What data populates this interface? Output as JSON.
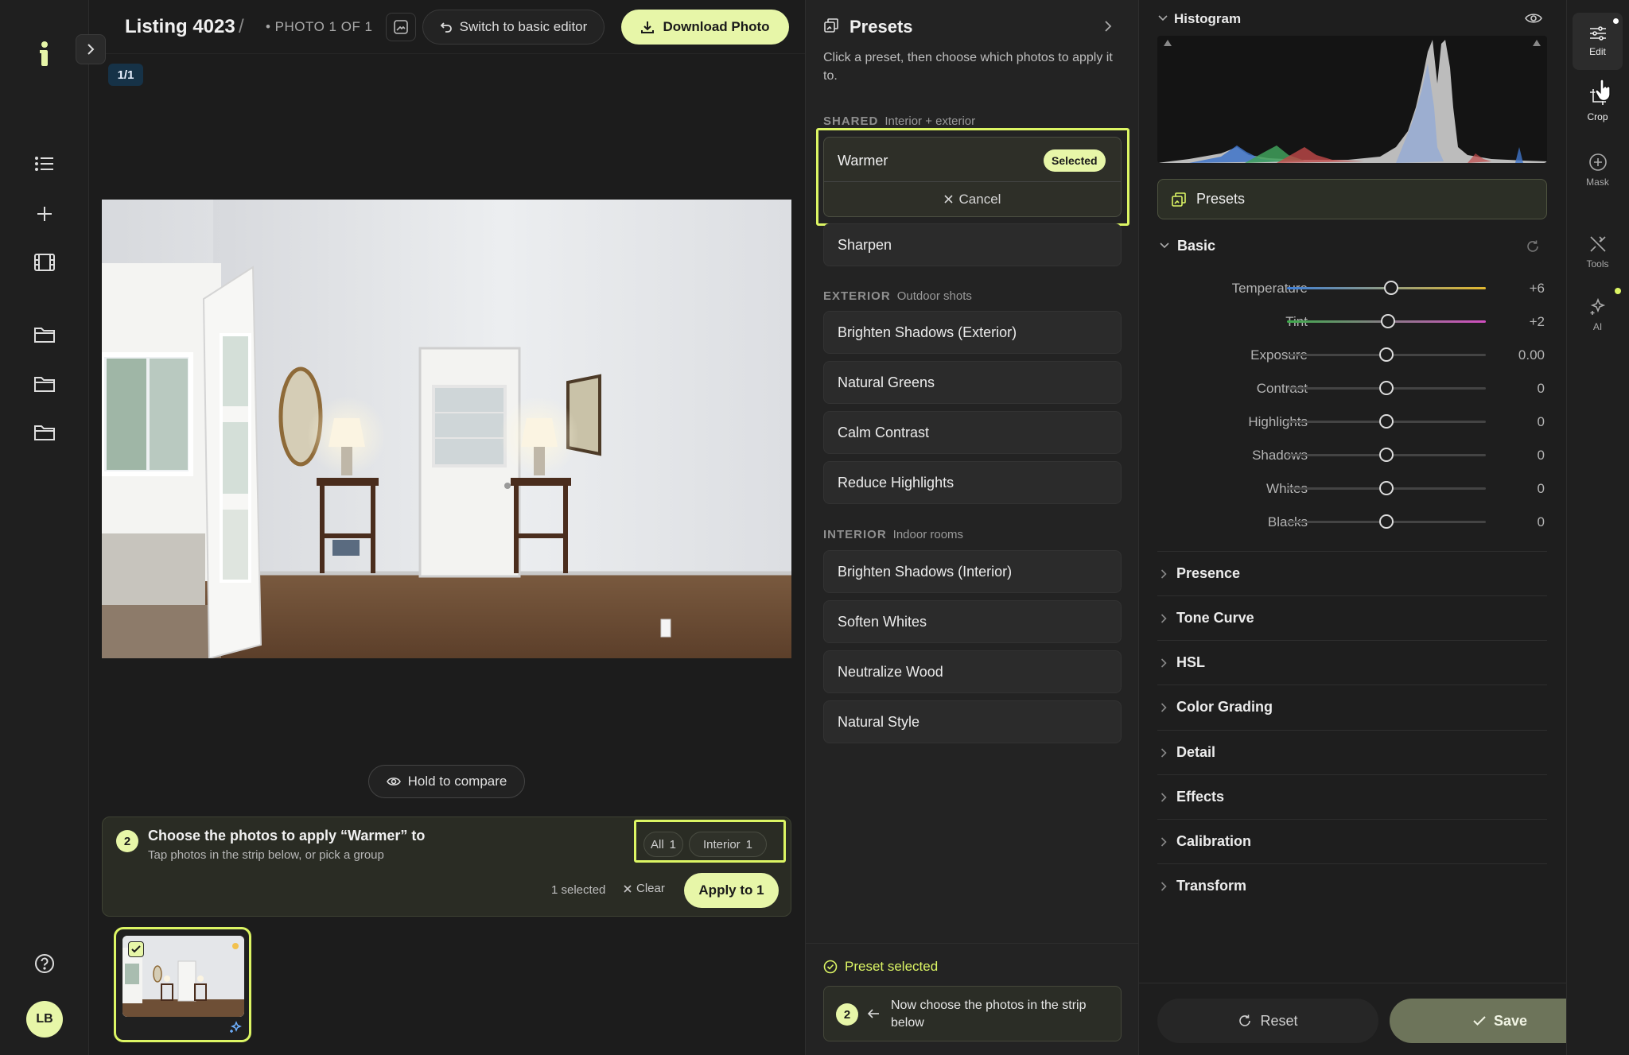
{
  "header": {
    "listing_title": "Listing 4023",
    "slash": "/",
    "photo_count": "• PHOTO 1 OF 1",
    "basic_editor_label": "Switch to basic editor",
    "download_label": "Download Photo"
  },
  "canvas": {
    "counter": "1/1",
    "hold_compare_label": "Hold to compare"
  },
  "sidebar": {
    "avatar_initials": "LB",
    "items": [
      "list-icon",
      "plus-icon",
      "film-icon",
      "folder-icon",
      "folder-icon",
      "folder-icon",
      "help-icon"
    ]
  },
  "apply_panel": {
    "step": "2",
    "title": "Choose the photos to apply “Warmer” to",
    "subtitle": "Tap photos in the strip below, or pick a group",
    "chips": [
      {
        "label": "All",
        "count": "1"
      },
      {
        "label": "Interior",
        "count": "1"
      }
    ],
    "selected_count": "1 selected",
    "clear_label": "Clear",
    "apply_label": "Apply to 1"
  },
  "presets": {
    "title": "Presets",
    "description": "Click a preset, then choose which photos to apply it to.",
    "shared_label": "SHARED",
    "shared_sub": "Interior + exterior",
    "warmer": "Warmer",
    "selected_badge": "Selected",
    "cancel_label": "Cancel",
    "shared_items": [
      "Sharpen"
    ],
    "exterior_label": "EXTERIOR",
    "exterior_sub": "Outdoor shots",
    "exterior_items": [
      "Brighten Shadows (Exterior)",
      "Natural Greens",
      "Calm Contrast",
      "Reduce Highlights"
    ],
    "interior_label": "INTERIOR",
    "interior_sub": "Indoor rooms",
    "interior_items": [
      "Brighten Shadows (Interior)",
      "Soften Whites",
      "Neutralize Wood",
      "Natural Style"
    ],
    "status": "Preset selected",
    "next_step_number": "2",
    "next_step_text": "Now choose the photos in the strip below"
  },
  "adjust": {
    "histogram_title": "Histogram",
    "presets_label": "Presets",
    "basic_title": "Basic",
    "sliders": [
      {
        "label": "Temperature",
        "value": "+6",
        "level": 0.524
      },
      {
        "label": "Tint",
        "value": "+2",
        "level": 0.508
      },
      {
        "label": "Exposure",
        "value": "0.00",
        "level": 0.5
      },
      {
        "label": "Contrast",
        "value": "0",
        "level": 0.5
      },
      {
        "label": "Highlights",
        "value": "0",
        "level": 0.5
      },
      {
        "label": "Shadows",
        "value": "0",
        "level": 0.5
      },
      {
        "label": "Whites",
        "value": "0",
        "level": 0.5
      },
      {
        "label": "Blacks",
        "value": "0",
        "level": 0.5
      }
    ],
    "sections": [
      "Presence",
      "Tone Curve",
      "HSL",
      "Color Grading",
      "Detail",
      "Effects",
      "Calibration",
      "Transform"
    ],
    "reset_label": "Reset",
    "save_label": "Save"
  },
  "tools": [
    {
      "label": "Edit",
      "icon": "sliders-icon"
    },
    {
      "label": "Crop",
      "icon": "crop-icon"
    },
    {
      "label": "Mask",
      "icon": "mask-icon"
    },
    {
      "label": "Tools",
      "icon": "tools-icon"
    },
    {
      "label": "AI",
      "icon": "ai-sparkle-icon"
    }
  ],
  "colors": {
    "accent": "#e7f6a8",
    "highlight_outline": "#dcf564",
    "counter_badge": "#163247"
  }
}
